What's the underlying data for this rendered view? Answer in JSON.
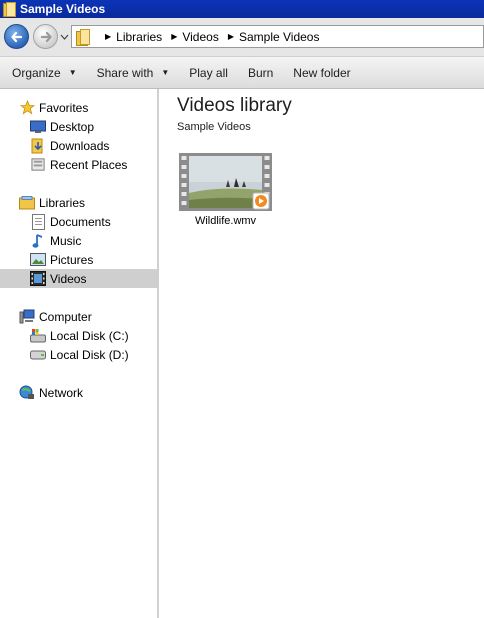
{
  "window": {
    "title": "Sample Videos"
  },
  "address": {
    "crumbs": [
      "Libraries",
      "Videos",
      "Sample Videos"
    ]
  },
  "toolbar": {
    "organize": "Organize",
    "share_with": "Share with",
    "play_all": "Play all",
    "burn": "Burn",
    "new_folder": "New folder"
  },
  "nav": {
    "favorites": {
      "label": "Favorites",
      "items": [
        "Desktop",
        "Downloads",
        "Recent Places"
      ]
    },
    "libraries": {
      "label": "Libraries",
      "items": [
        "Documents",
        "Music",
        "Pictures",
        "Videos"
      ],
      "selected": "Videos"
    },
    "computer": {
      "label": "Computer",
      "items": [
        "Local Disk (C:)",
        "Local Disk (D:)"
      ]
    },
    "network": {
      "label": "Network"
    }
  },
  "content": {
    "title": "Videos library",
    "subtitle": "Sample Videos",
    "files": [
      {
        "name": "Wildlife.wmv",
        "icon": "video-file-icon"
      }
    ]
  },
  "colors": {
    "titlebar": "#0a2a9c",
    "selection": "#cfcfcf"
  }
}
